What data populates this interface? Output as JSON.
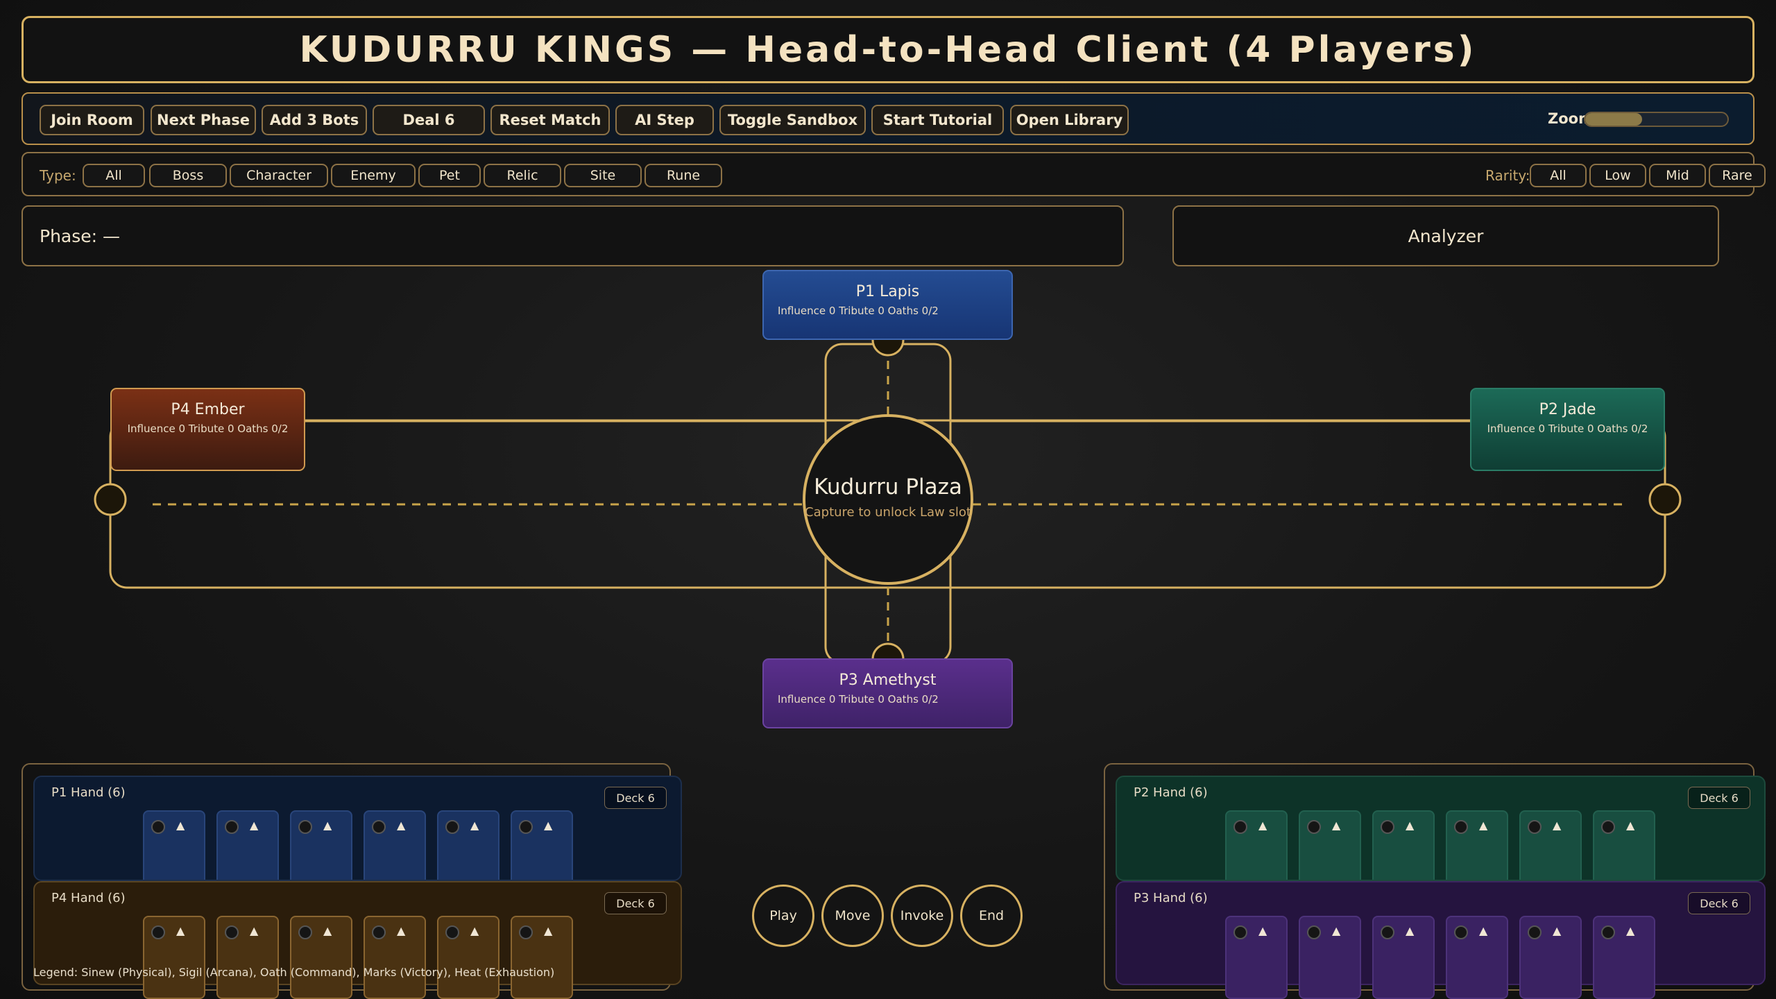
{
  "title": "KUDURRU KINGS — Head-to-Head Client (4 Players)",
  "toolbar": {
    "buttons": [
      "Join Room",
      "Next Phase",
      "Add 3 Bots",
      "Deal 6",
      "Reset Match",
      "AI Step",
      "Toggle Sandbox",
      "Start Tutorial",
      "Open Library"
    ],
    "zoom_label": "Zoom",
    "zoom_level": 0.4
  },
  "filters": {
    "type_label": "Type:",
    "types": [
      "All",
      "Boss",
      "Character",
      "Enemy",
      "Pet",
      "Relic",
      "Site",
      "Rune"
    ],
    "rarity_label": "Rarity:",
    "rarities": [
      "All",
      "Low",
      "Mid",
      "Rare"
    ]
  },
  "phase_text": "Phase: —",
  "analyzer_label": "Analyzer",
  "players": {
    "p1": {
      "name": "P1 Lapis",
      "stats": "Influence 0 Tribute 0 Oaths 0/2"
    },
    "p2": {
      "name": "P2 Jade",
      "stats": "Influence 0 Tribute 0 Oaths 0/2"
    },
    "p3": {
      "name": "P3 Amethyst",
      "stats": "Influence 0 Tribute 0 Oaths 0/2"
    },
    "p4": {
      "name": "P4 Ember",
      "stats": "Influence 0 Tribute 0 Oaths 0/2"
    }
  },
  "plaza": {
    "name": "Kudurru Plaza",
    "subtitle": "Capture to unlock Law slot"
  },
  "hands": {
    "p1": {
      "label": "P1 Hand (6)",
      "deck": "Deck 6"
    },
    "p2": {
      "label": "P2 Hand (6)",
      "deck": "Deck 6"
    },
    "p3": {
      "label": "P3 Hand (6)",
      "deck": "Deck 6"
    },
    "p4": {
      "label": "P4 Hand (6)",
      "deck": "Deck 6"
    }
  },
  "card_marker": "▲",
  "actions": [
    "Play",
    "Move",
    "Invoke",
    "End"
  ],
  "legend": "Legend: Sinew (Physical), Sigil (Arcana), Oath (Command), Marks (Victory), Heat (Exhaustion)",
  "colors": {
    "accent": "#d7b161",
    "p1": "#1f4488",
    "p2": "#176050",
    "p3": "#512a80",
    "p4": "#7b3015"
  }
}
